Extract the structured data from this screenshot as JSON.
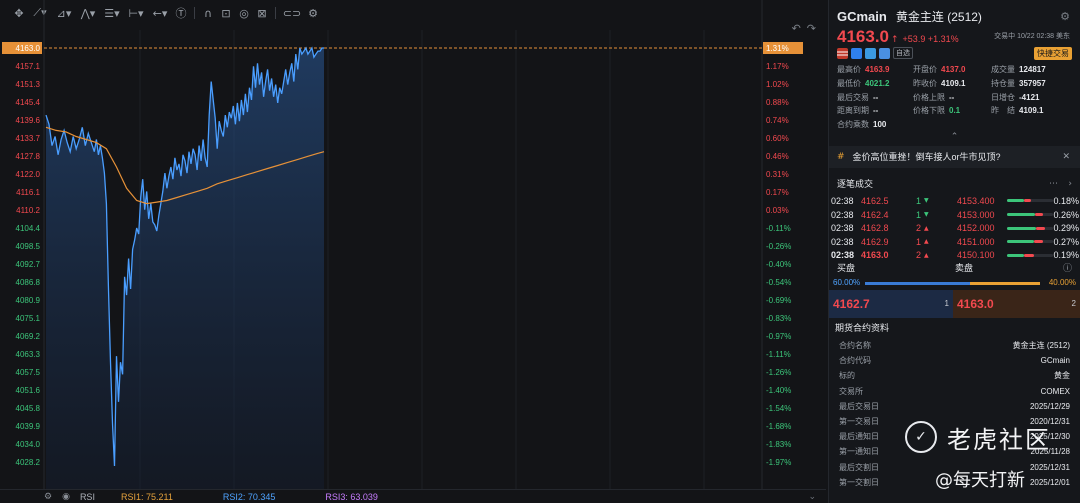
{
  "chart_data": {
    "type": "line",
    "title": "",
    "y_left_ticks": [
      "4163.0",
      "4157.1",
      "4151.3",
      "4145.4",
      "4139.6",
      "4133.7",
      "4127.8",
      "4122.0",
      "4116.1",
      "4110.2",
      "4104.4",
      "4098.5",
      "4092.7",
      "4086.8",
      "4080.9",
      "4075.1",
      "4069.2",
      "4063.3",
      "4057.5",
      "4051.6",
      "4045.8",
      "4039.9",
      "4034.0",
      "4028.2"
    ],
    "y_right_ticks": [
      "1.31%",
      "1.17%",
      "1.02%",
      "0.88%",
      "0.74%",
      "0.60%",
      "0.46%",
      "0.31%",
      "0.17%",
      "0.03%",
      "-0.11%",
      "-0.26%",
      "-0.40%",
      "-0.54%",
      "-0.69%",
      "-0.83%",
      "-0.97%",
      "-1.11%",
      "-1.26%",
      "-1.40%",
      "-1.54%",
      "-1.68%",
      "-1.83%",
      "-1.97%"
    ],
    "ylim": [
      4024.0,
      4165.0
    ],
    "last_price": 4163.0,
    "series": [
      {
        "type": "line",
        "color": "#4a9eff",
        "x": [
          0,
          3,
          6,
          9,
          12,
          15,
          18,
          21,
          24,
          27,
          30,
          33,
          36,
          39,
          42,
          45,
          48,
          50,
          52,
          54,
          56,
          58,
          60,
          62,
          64,
          66,
          68,
          70,
          72,
          74,
          76,
          78,
          80,
          82,
          84,
          86,
          88,
          90,
          92,
          94,
          96,
          98,
          100,
          102,
          104,
          106,
          108,
          110,
          112,
          114,
          116,
          118,
          120,
          122,
          124,
          126,
          128,
          130,
          132,
          134,
          136,
          138,
          140,
          142,
          144,
          146,
          148,
          150,
          152,
          154,
          156,
          158,
          160,
          162,
          164,
          166,
          168,
          170,
          172,
          174,
          176,
          178,
          180,
          182,
          184,
          186,
          188,
          190,
          192,
          194,
          196,
          198,
          200,
          202,
          204,
          206,
          208,
          210,
          212,
          214,
          216,
          218,
          220,
          222,
          224,
          226,
          228,
          230,
          232,
          234,
          236,
          238,
          240,
          242,
          244,
          246,
          248,
          250,
          252,
          254,
          256,
          258,
          260,
          262,
          264,
          266,
          268,
          270,
          272,
          274,
          276
        ],
        "values": [
          4141,
          4138,
          4131,
          4134,
          4128,
          4133,
          4136,
          4132,
          4129,
          4134,
          4130,
          4133,
          4137,
          4131,
          4135,
          4132,
          4129,
          4133,
          4128,
          4131,
          4127,
          4122,
          4112,
          4085,
          4060,
          4040,
          4026,
          4062,
          4047,
          4060,
          4056,
          4088,
          4082,
          4094,
          4084,
          4097,
          4100,
          4104,
          4102,
          4114,
          4120,
          4110,
          4116,
          4107,
          4112,
          4106,
          4105,
          4103,
          4108,
          4112,
          4116,
          4122,
          4117,
          4121,
          4124,
          4120,
          4127,
          4123,
          4125,
          4121,
          4128,
          4126,
          4122,
          4129,
          4125,
          4130,
          4128,
          4123,
          4131,
          4126,
          4133,
          4127,
          4124,
          4141,
          4152,
          4146,
          4140,
          4130,
          4139,
          4136,
          4134,
          4141,
          4137,
          4142,
          4140,
          4144,
          4138,
          4145,
          4139,
          4146,
          4141,
          4148,
          4142,
          4150,
          4146,
          4157,
          4150,
          4158,
          4151,
          4155,
          4147,
          4152,
          4156,
          4149,
          4153,
          4147,
          4151,
          4145,
          4150,
          4148,
          4152,
          4156,
          4151,
          4155,
          4158,
          4152,
          4161,
          4156,
          4163,
          4161,
          4162,
          4163,
          4161,
          4162,
          4163,
          4160,
          4161,
          4162,
          4162,
          4163,
          4163
        ]
      },
      {
        "type": "line",
        "color": "#e69138",
        "x": [
          0,
          10,
          20,
          30,
          40,
          50,
          60,
          70,
          80,
          90,
          100,
          110,
          120,
          130,
          140,
          150,
          160,
          170,
          180,
          190,
          200,
          210,
          220,
          230,
          240,
          250,
          260,
          270,
          276
        ],
        "values": [
          4137,
          4136,
          4135.5,
          4134,
          4133,
          4132,
          4130,
          4124,
          4117,
          4113,
          4112,
          4112.5,
          4113,
          4114,
          4115,
          4116,
          4117,
          4118.5,
          4119.5,
          4120.5,
          4121.5,
          4122.5,
          4123.5,
          4124.5,
          4125.5,
          4126.5,
          4127.5,
          4128.5,
          4129
        ]
      }
    ]
  },
  "rsi_bar": {
    "label": "RSI",
    "rsi1": "RSI1: 75.211",
    "rsi2": "RSI2: 70.345",
    "rsi3": "RSI3: 63.039"
  },
  "header": {
    "symbol": "GCmain",
    "name": "黄金主连 (2512)",
    "price": "4163.0",
    "change": "+53.9 +1.31%",
    "status": "交易中 10/22 02:38 美东",
    "watchlist": "自选",
    "quick_trade": "快捷交易"
  },
  "stats": [
    {
      "k": "最高价",
      "v": "4163.9",
      "cls": "red"
    },
    {
      "k": "开盘价",
      "v": "4137.0",
      "cls": "red"
    },
    {
      "k": "成交量",
      "v": "124817",
      "cls": ""
    },
    {
      "k": "最低价",
      "v": "4021.2",
      "cls": "green"
    },
    {
      "k": "昨收价",
      "v": "4109.1",
      "cls": ""
    },
    {
      "k": "持仓量",
      "v": "357957",
      "cls": ""
    },
    {
      "k": "最后交易",
      "v": "--",
      "cls": ""
    },
    {
      "k": "价格上限",
      "v": "--",
      "cls": ""
    },
    {
      "k": "日增仓",
      "v": "-4121",
      "cls": ""
    },
    {
      "k": "距离到期",
      "v": "--",
      "cls": ""
    },
    {
      "k": "价格下限",
      "v": "0.1",
      "cls": "green"
    },
    {
      "k": "昨　结",
      "v": "4109.1",
      "cls": ""
    },
    {
      "k": "合约乘数",
      "v": "100",
      "cls": ""
    }
  ],
  "news": "金价高位重挫！倒车接人or牛市见顶?",
  "ticks_title": "逐笔成交",
  "ticks": [
    {
      "t": "02:38",
      "p": "4162.5",
      "q": "1",
      "d": "▼",
      "dir": "down"
    },
    {
      "t": "02:38",
      "p": "4162.4",
      "q": "1",
      "d": "▼",
      "dir": "down"
    },
    {
      "t": "02:38",
      "p": "4162.8",
      "q": "2",
      "d": "▲",
      "dir": "up"
    },
    {
      "t": "02:38",
      "p": "4162.9",
      "q": "1",
      "d": "▲",
      "dir": "up"
    },
    {
      "t": "02:38",
      "p": "4163.0",
      "q": "2",
      "d": "▲",
      "dir": "up"
    }
  ],
  "distribution": [
    {
      "p": "4153.400",
      "pct": "0.18%",
      "g": 0.36,
      "r": 0.16
    },
    {
      "p": "4153.000",
      "pct": "0.26%",
      "g": 0.6,
      "r": 0.18
    },
    {
      "p": "4152.000",
      "pct": "0.29%",
      "g": 0.62,
      "r": 0.2
    },
    {
      "p": "4151.000",
      "pct": "0.27%",
      "g": 0.58,
      "r": 0.2
    },
    {
      "p": "4150.100",
      "pct": "0.19%",
      "g": 0.38,
      "r": 0.2
    }
  ],
  "bs": {
    "buy_label": "买盘",
    "sell_label": "卖盘",
    "buy_pct": "60.00%",
    "sell_pct": "40.00%",
    "buy_ratio": 0.6,
    "bid": "4162.7",
    "bid_count": "1",
    "ask": "4163.0",
    "ask_count": "2"
  },
  "futures_title": "期货合约资料",
  "futures": [
    {
      "k": "合约名称",
      "v": "黄金主连 (2512)"
    },
    {
      "k": "合约代码",
      "v": "GCmain"
    },
    {
      "k": "标的",
      "v": "黄金"
    },
    {
      "k": "交易所",
      "v": "COMEX"
    },
    {
      "k": "最后交易日",
      "v": "2025/12/29"
    },
    {
      "k": "第一交易日",
      "v": "2020/12/31"
    },
    {
      "k": "最后通知日",
      "v": "2025/12/30"
    },
    {
      "k": "第一通知日",
      "v": "2025/11/28"
    },
    {
      "k": "最后交割日",
      "v": "2025/12/31"
    },
    {
      "k": "第一交割日",
      "v": "2025/12/01"
    }
  ],
  "watermark": {
    "brand": "老虎社区",
    "author": "@每天打新"
  }
}
